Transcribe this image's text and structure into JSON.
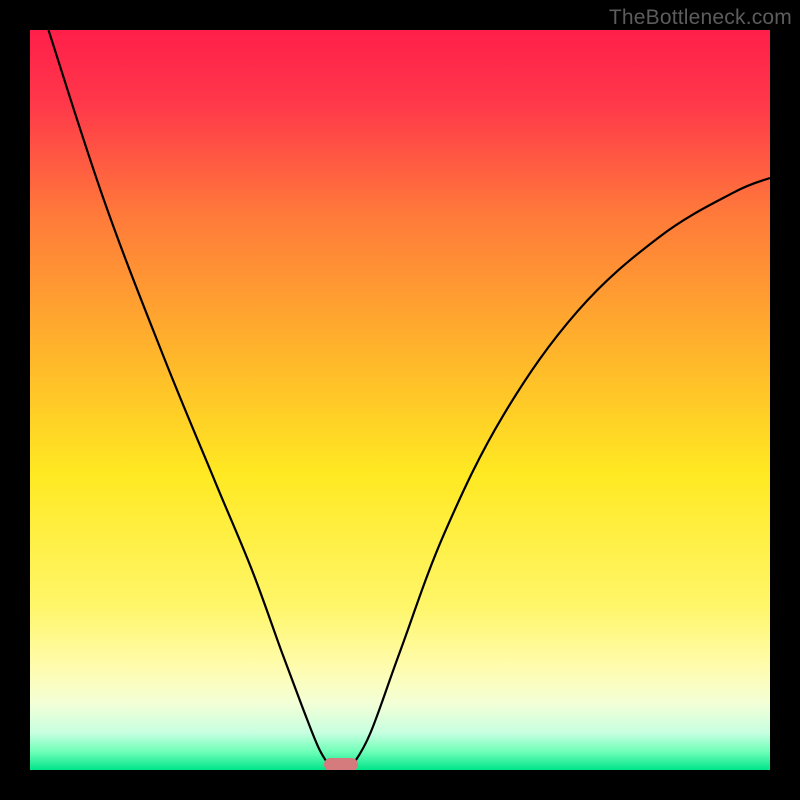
{
  "watermark": "TheBottleneck.com",
  "chart_data": {
    "type": "line",
    "title": "",
    "xlabel": "",
    "ylabel": "",
    "xlim": [
      0,
      100
    ],
    "ylim": [
      0,
      100
    ],
    "gradient_stops": [
      {
        "pos": 0.0,
        "color": "#ff1f4a"
      },
      {
        "pos": 0.1,
        "color": "#ff384a"
      },
      {
        "pos": 0.25,
        "color": "#ff7a3a"
      },
      {
        "pos": 0.45,
        "color": "#ffb92a"
      },
      {
        "pos": 0.6,
        "color": "#ffe922"
      },
      {
        "pos": 0.78,
        "color": "#fff66a"
      },
      {
        "pos": 0.86,
        "color": "#fffcad"
      },
      {
        "pos": 0.91,
        "color": "#f3ffd7"
      },
      {
        "pos": 0.95,
        "color": "#c6ffe0"
      },
      {
        "pos": 0.975,
        "color": "#70ffb8"
      },
      {
        "pos": 1.0,
        "color": "#00e58a"
      }
    ],
    "curve_left": [
      {
        "x": 2.5,
        "y": 100
      },
      {
        "x": 10,
        "y": 77
      },
      {
        "x": 18,
        "y": 56
      },
      {
        "x": 25,
        "y": 39
      },
      {
        "x": 30,
        "y": 27
      },
      {
        "x": 34,
        "y": 16
      },
      {
        "x": 37,
        "y": 8
      },
      {
        "x": 39,
        "y": 3
      },
      {
        "x": 40.5,
        "y": 0.5
      }
    ],
    "curve_right": [
      {
        "x": 43.5,
        "y": 0.5
      },
      {
        "x": 46,
        "y": 5
      },
      {
        "x": 50,
        "y": 16
      },
      {
        "x": 56,
        "y": 32
      },
      {
        "x": 64,
        "y": 48
      },
      {
        "x": 74,
        "y": 62
      },
      {
        "x": 85,
        "y": 72
      },
      {
        "x": 95,
        "y": 78
      },
      {
        "x": 100,
        "y": 80
      }
    ],
    "min_marker": {
      "x": 42,
      "y": 0,
      "color": "#d57a7d"
    }
  }
}
